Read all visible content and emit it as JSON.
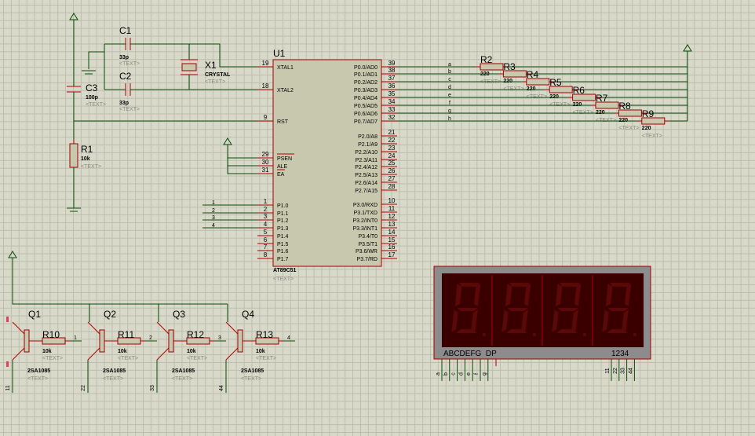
{
  "colors": {
    "wire": "#0a4a0a",
    "pin": "#b00000",
    "component_body": "#c8c8ae",
    "display_bg": "#3a0000",
    "segment_off": "#5a0808",
    "sheet": "#d9d9c9"
  },
  "placeholder_text": "<TEXT>",
  "u1": {
    "ref": "U1",
    "part": "AT89C51",
    "left_pins": [
      {
        "num": "19",
        "name": "XTAL1"
      },
      {
        "num": "18",
        "name": "XTAL2"
      },
      {
        "num": "9",
        "name": "RST"
      },
      {
        "num": "29",
        "name": "PSEN"
      },
      {
        "num": "30",
        "name": "ALE"
      },
      {
        "num": "31",
        "name": "EA"
      },
      {
        "num": "1",
        "name": "P1.0"
      },
      {
        "num": "2",
        "name": "P1.1"
      },
      {
        "num": "3",
        "name": "P1.2"
      },
      {
        "num": "4",
        "name": "P1.3"
      },
      {
        "num": "5",
        "name": "P1.4"
      },
      {
        "num": "6",
        "name": "P1.5"
      },
      {
        "num": "7",
        "name": "P1.6"
      },
      {
        "num": "8",
        "name": "P1.7"
      }
    ],
    "right_pins": [
      {
        "num": "39",
        "name": "P0.0/AD0"
      },
      {
        "num": "38",
        "name": "P0.1/AD1"
      },
      {
        "num": "37",
        "name": "P0.2/AD2"
      },
      {
        "num": "36",
        "name": "P0.3/AD3"
      },
      {
        "num": "35",
        "name": "P0.4/AD4"
      },
      {
        "num": "34",
        "name": "P0.5/AD5"
      },
      {
        "num": "33",
        "name": "P0.6/AD6"
      },
      {
        "num": "32",
        "name": "P0.7/AD7"
      },
      {
        "num": "21",
        "name": "P2.0/A8"
      },
      {
        "num": "22",
        "name": "P2.1/A9"
      },
      {
        "num": "23",
        "name": "P2.2/A10"
      },
      {
        "num": "24",
        "name": "P2.3/A11"
      },
      {
        "num": "25",
        "name": "P2.4/A12"
      },
      {
        "num": "26",
        "name": "P2.5/A13"
      },
      {
        "num": "27",
        "name": "P2.6/A14"
      },
      {
        "num": "28",
        "name": "P2.7/A15"
      },
      {
        "num": "10",
        "name": "P3.0/RXD"
      },
      {
        "num": "11",
        "name": "P3.1/TXD"
      },
      {
        "num": "12",
        "name": "P3.2/INT0"
      },
      {
        "num": "13",
        "name": "P3.3/INT1"
      },
      {
        "num": "14",
        "name": "P3.4/T0"
      },
      {
        "num": "15",
        "name": "P3.5/T1"
      },
      {
        "num": "16",
        "name": "P3.6/WR"
      },
      {
        "num": "17",
        "name": "P3.7/RD"
      }
    ]
  },
  "c1": {
    "ref": "C1",
    "value": "33p"
  },
  "c2": {
    "ref": "C2",
    "value": "33p"
  },
  "c3": {
    "ref": "C3",
    "value": "100p"
  },
  "x1": {
    "ref": "X1",
    "value": "CRYSTAL"
  },
  "r1": {
    "ref": "R1",
    "value": "10k"
  },
  "p0_net_labels": [
    "a",
    "b",
    "c",
    "d",
    "e",
    "f",
    "g",
    "h"
  ],
  "p1_net_labels": [
    "1",
    "2",
    "3",
    "4"
  ],
  "pullups": [
    {
      "ref": "R2",
      "value": "220"
    },
    {
      "ref": "R3",
      "value": "220"
    },
    {
      "ref": "R4",
      "value": "220"
    },
    {
      "ref": "R5",
      "value": "220"
    },
    {
      "ref": "R6",
      "value": "220"
    },
    {
      "ref": "R7",
      "value": "220"
    },
    {
      "ref": "R8",
      "value": "220"
    },
    {
      "ref": "R9",
      "value": "220"
    }
  ],
  "drivers": [
    {
      "q": "Q1",
      "part": "2SA1085",
      "r": "R10",
      "rval": "10k",
      "net": "1",
      "col": "11"
    },
    {
      "q": "Q2",
      "part": "2SA1085",
      "r": "R11",
      "rval": "10k",
      "net": "2",
      "col": "22"
    },
    {
      "q": "Q3",
      "part": "2SA1085",
      "r": "R12",
      "rval": "10k",
      "net": "3",
      "col": "33"
    },
    {
      "q": "Q4",
      "part": "2SA1085",
      "r": "R13",
      "rval": "10k",
      "net": "4",
      "col": "44"
    }
  ],
  "display": {
    "segment_label": "ABCDEFG  DP",
    "digit_label": "1234",
    "digits": 4,
    "seg_pins": [
      "a",
      "b",
      "c",
      "d",
      "e",
      "f",
      "g"
    ],
    "com_pins": [
      "11",
      "22",
      "33",
      "44"
    ]
  }
}
